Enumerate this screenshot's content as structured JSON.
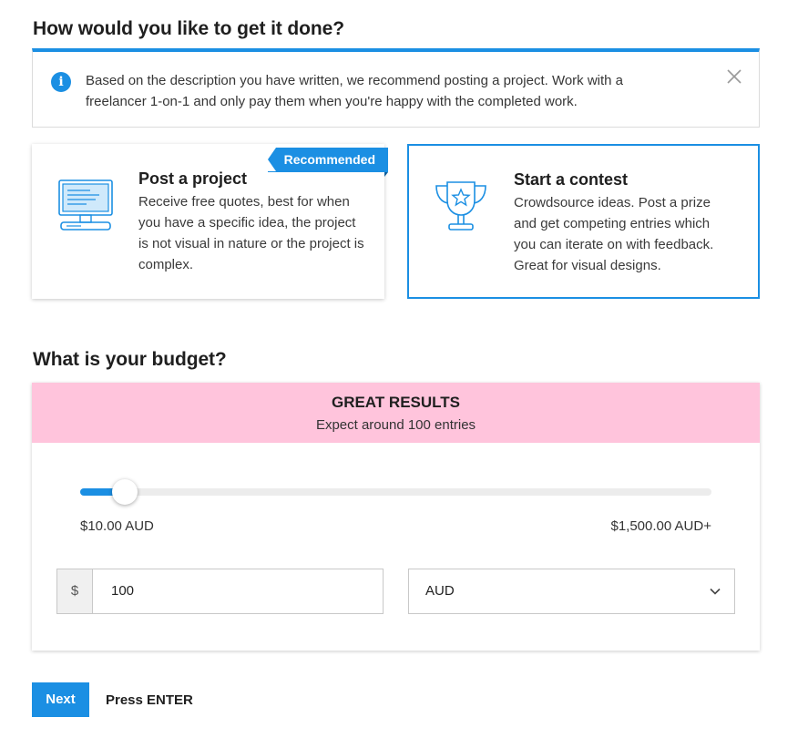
{
  "method": {
    "heading": "How would you like to get it done?",
    "info": {
      "text": "Based on the description you have written, we recommend posting a project. Work with a freelancer 1-on-1 and only pay them when you're happy with the completed work.",
      "icon": "info-icon"
    },
    "cards": [
      {
        "title": "Post a project",
        "description": "Receive free quotes, best for when you have a specific idea, the project is not visual in nature or the project is complex.",
        "badge": "Recommended",
        "icon": "computer-monitor-icon"
      },
      {
        "title": "Start a contest",
        "description": "Crowdsource ideas. Post a prize and get competing entries which you can iterate on with feedback. Great for visual designs.",
        "icon": "trophy-icon",
        "selected": true
      }
    ]
  },
  "budget": {
    "heading": "What is your budget?",
    "rating": {
      "title": "GREAT RESULTS",
      "subtitle": "Expect around 100 entries"
    },
    "slider": {
      "min_label": "$10.00 AUD",
      "max_label": "$1,500.00 AUD+",
      "fraction": 0.07
    },
    "amount": {
      "prefix": "$",
      "value": "100"
    },
    "currency": {
      "value": "AUD"
    }
  },
  "actions": {
    "next_label": "Next",
    "hint": "Press ENTER"
  },
  "colors": {
    "accent": "#1b8fe3",
    "rating_band": "#ffc4dc"
  }
}
